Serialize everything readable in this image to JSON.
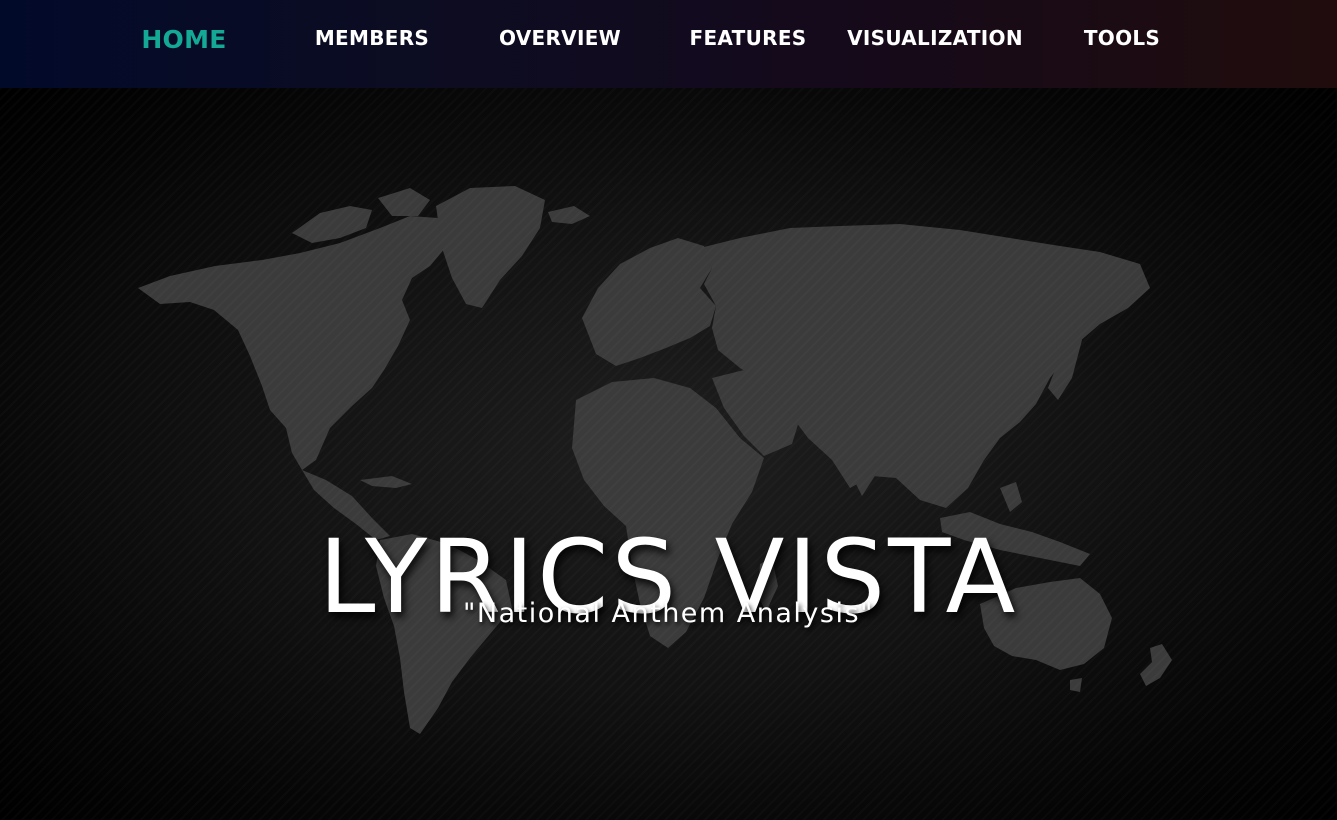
{
  "nav": {
    "items": [
      {
        "label": "HOME",
        "active": true
      },
      {
        "label": "MEMBERS",
        "active": false
      },
      {
        "label": "OVERVIEW",
        "active": false
      },
      {
        "label": "FEATURES",
        "active": false
      },
      {
        "label": "VISUALIZATION",
        "active": false
      },
      {
        "label": "TOOLS",
        "active": false
      }
    ],
    "active_color": "#13a995",
    "text_color": "#ffffff"
  },
  "hero": {
    "title": "LYRICS VISTA",
    "subtitle": "\"National Anthem Analysis\"",
    "background_image": "world-map"
  }
}
